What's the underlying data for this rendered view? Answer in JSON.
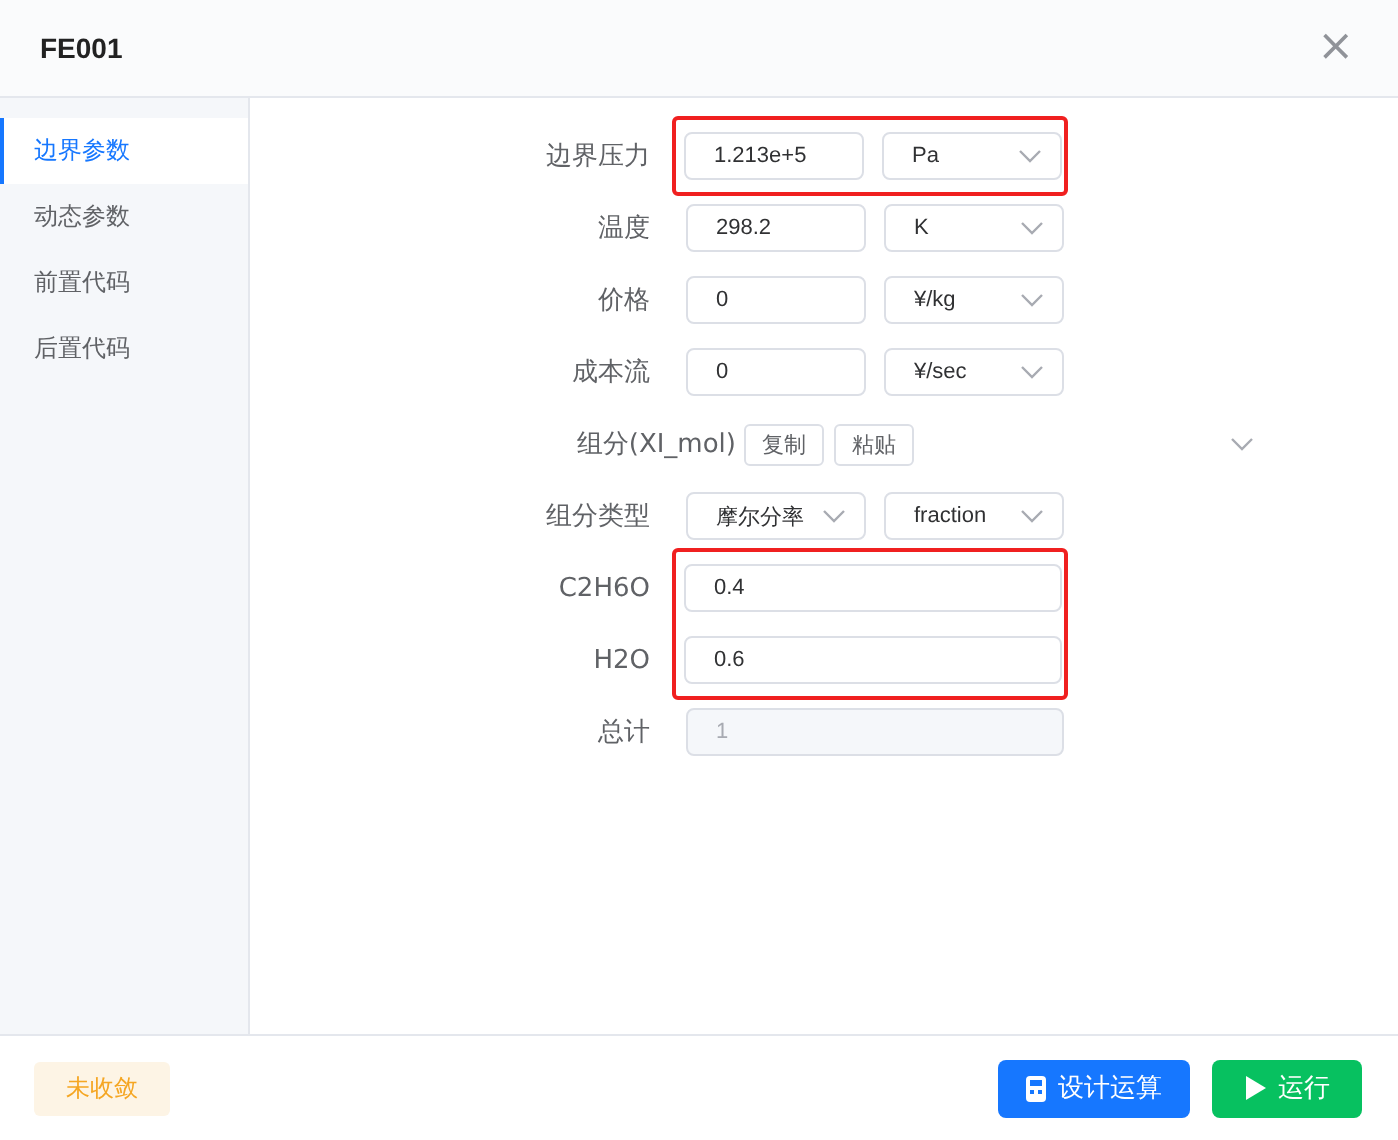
{
  "window": {
    "title": "FE001",
    "close": "×"
  },
  "sidebar": {
    "items": [
      {
        "label": "边界参数",
        "selected": true
      },
      {
        "label": "动态参数",
        "selected": false
      },
      {
        "label": "前置代码",
        "selected": false
      },
      {
        "label": "后置代码",
        "selected": false
      }
    ]
  },
  "form": {
    "rows": [
      {
        "kind": "value_unit",
        "label": "边界压力",
        "value": "1.213e+5",
        "unit": "Pa",
        "highlighted": true
      },
      {
        "kind": "value_unit",
        "label": "温度",
        "value": "298.2",
        "unit": "K",
        "highlighted": false
      },
      {
        "kind": "value_unit",
        "label": "价格",
        "value": "0",
        "unit": "¥/kg",
        "highlighted": false
      },
      {
        "kind": "value_unit",
        "label": "成本流",
        "value": "0",
        "unit": "¥/sec",
        "highlighted": false
      },
      {
        "kind": "components",
        "label": "组分(XI_mol)",
        "buttons": [
          "复制",
          "粘贴"
        ],
        "expanded": false,
        "highlighted": false
      },
      {
        "kind": "two_selects",
        "label": "组分类型",
        "unit": "摩尔分率",
        "unit2": "fraction",
        "highlighted": false
      },
      {
        "kind": "value",
        "label": "C2H6O",
        "value": "0.4",
        "highlighted": true
      },
      {
        "kind": "value",
        "label": "H2O",
        "value": "0.6",
        "highlighted": true
      },
      {
        "kind": "readonly",
        "label": "总计",
        "value": "1",
        "highlighted": false
      }
    ]
  },
  "footer": {
    "status": "未收敛",
    "buttons": [
      {
        "kind": "design",
        "label": "设计运算"
      },
      {
        "kind": "run",
        "label": "运行"
      }
    ]
  }
}
